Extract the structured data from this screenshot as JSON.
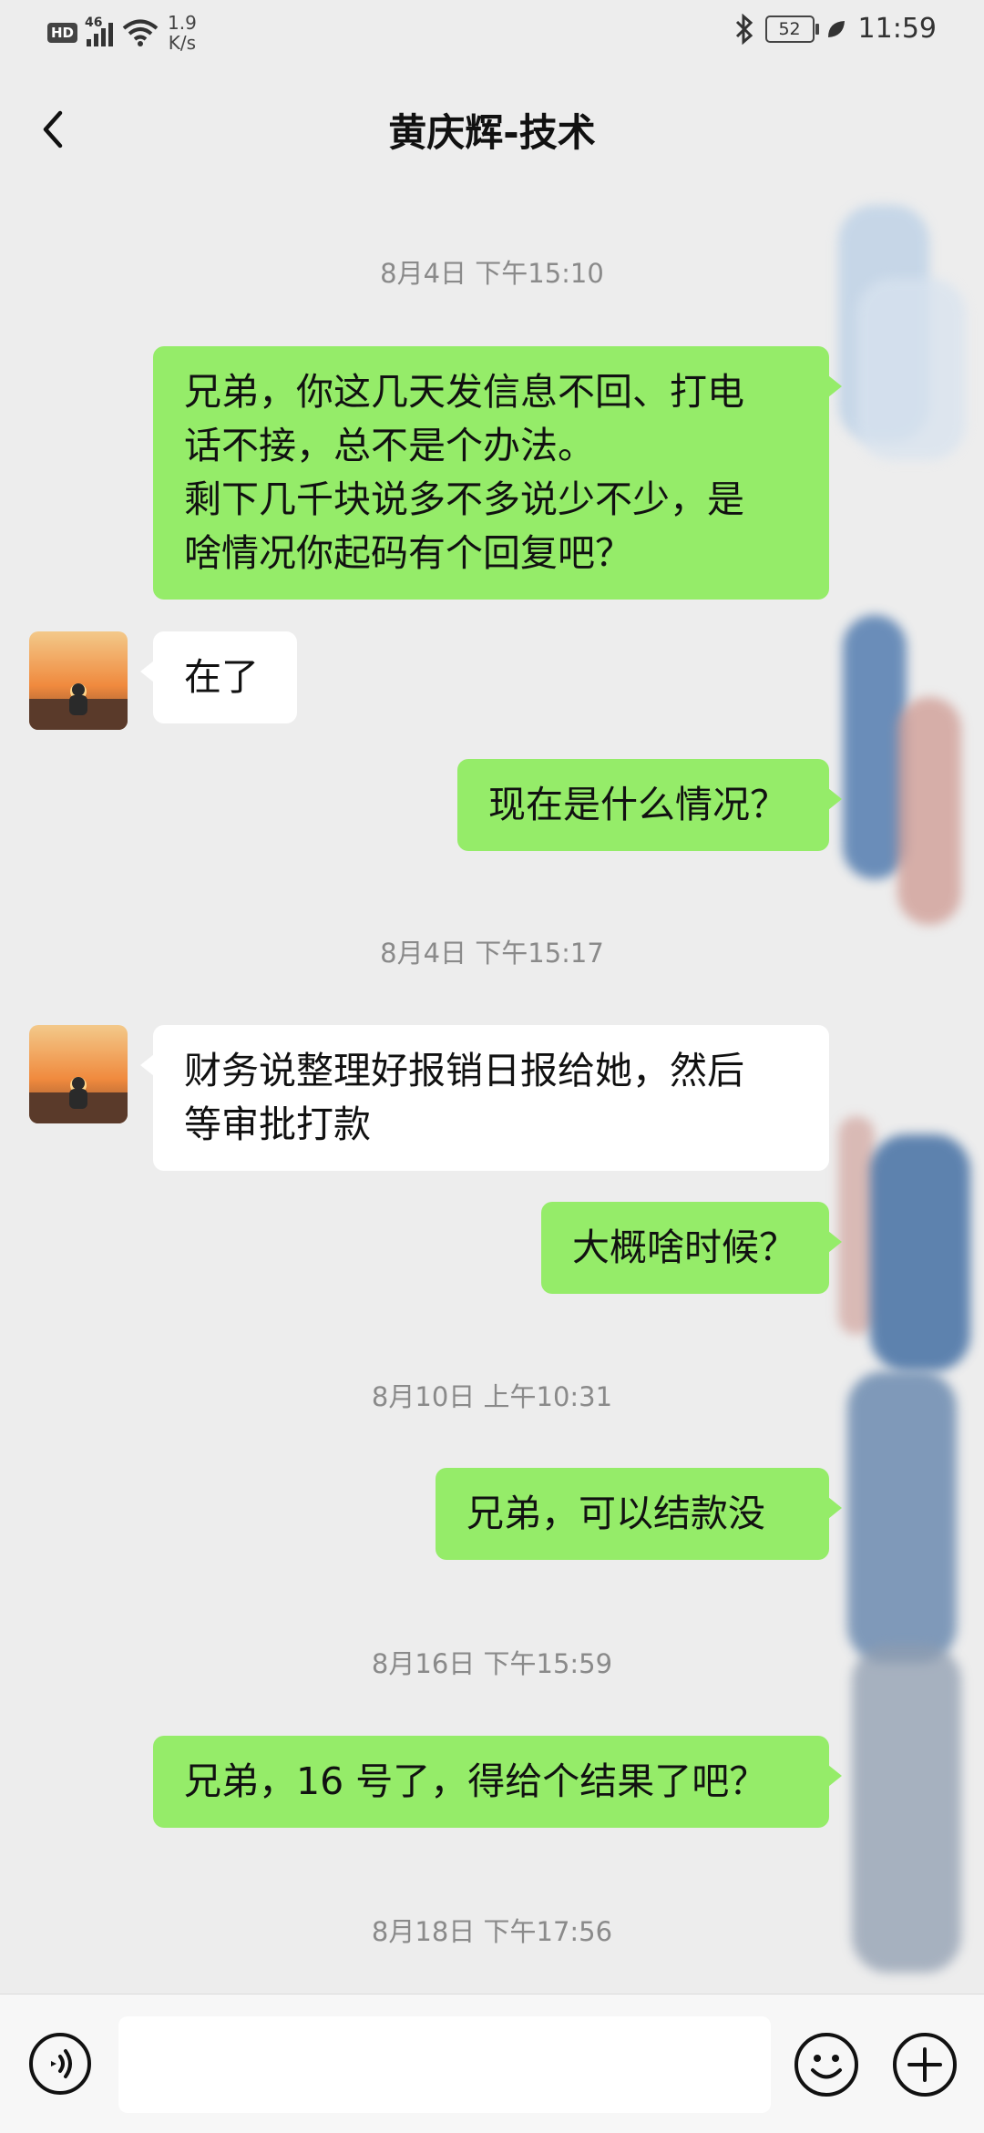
{
  "status_bar": {
    "hd": "HD",
    "network": "46",
    "speed_value": "1.9",
    "speed_unit": "K/s",
    "battery": "52",
    "time": "11:59"
  },
  "nav": {
    "title": "黄庆辉-技术"
  },
  "chat": {
    "timestamps": [
      "8月4日 下午15:10",
      "8月4日 下午15:17",
      "8月10日 上午10:31",
      "8月16日 下午15:59",
      "8月18日 下午17:56"
    ],
    "messages": [
      {
        "sender": "me",
        "lines": [
          "兄弟，你这几天发信息不回、打电",
          "话不接，总不是个办法。",
          "剩下几千块说多不多说少不少，是",
          "啥情况你起码有个回复吧？"
        ]
      },
      {
        "sender": "them",
        "lines": [
          "在了"
        ]
      },
      {
        "sender": "me",
        "lines": [
          "现在是什么情况？"
        ]
      },
      {
        "sender": "them",
        "lines": [
          "财务说整理好报销日报给她，然后",
          "等审批打款"
        ]
      },
      {
        "sender": "me",
        "lines": [
          "大概啥时候？"
        ]
      },
      {
        "sender": "me",
        "lines": [
          "兄弟，可以结款没"
        ]
      },
      {
        "sender": "me",
        "lines": [
          "兄弟，16 号了，得给个结果了吧？"
        ]
      }
    ]
  },
  "colors": {
    "my_bubble": "#95ec69",
    "their_bubble": "#ffffff",
    "background": "#ededed"
  },
  "icons": {
    "back": "chevron-left-icon",
    "voice": "voice-icon",
    "emoji": "emoji-icon",
    "plus": "plus-icon",
    "bluetooth": "bluetooth-icon",
    "wifi": "wifi-icon",
    "leaf": "leaf-icon"
  }
}
